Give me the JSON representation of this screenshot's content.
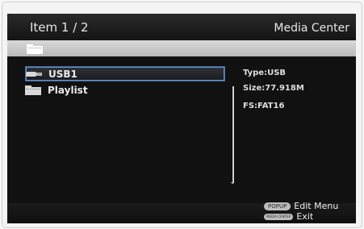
{
  "header": {
    "item_label": "Item  1 / 2",
    "app_title": "Media Center"
  },
  "list": [
    {
      "label": "USB1",
      "icon": "usb-drive-icon",
      "selected": true
    },
    {
      "label": "Playlist",
      "icon": "folder-icon",
      "selected": false
    }
  ],
  "info": {
    "type": "Type:USB",
    "size": "Size:77.918M",
    "fs": "FS:FAT16"
  },
  "footer": {
    "popup_key": "POPUP",
    "popup_action": "Edit Menu",
    "menu_key": "MEDIA CENTER",
    "menu_action": "Exit"
  },
  "colors": {
    "selection_border": "#3f6aa8",
    "header_text": "#e6e6e6"
  }
}
